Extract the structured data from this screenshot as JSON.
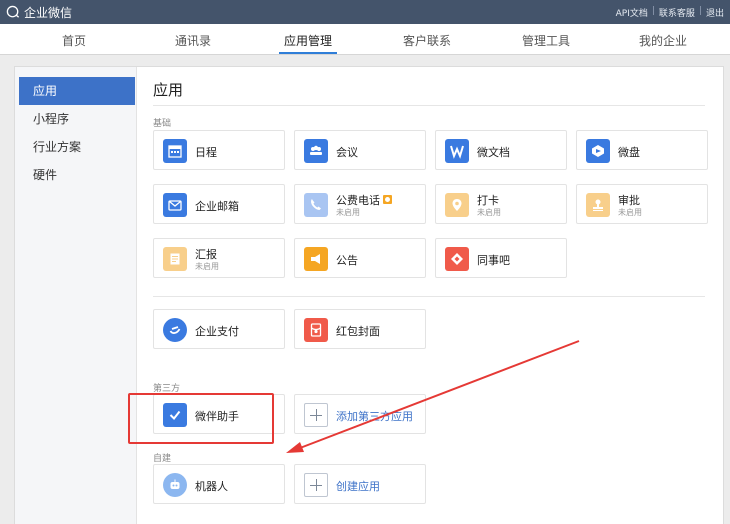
{
  "topbar": {
    "logo_text": "企业微信",
    "links": [
      "API文档",
      "联系客服",
      "退出"
    ]
  },
  "nav": {
    "items": [
      {
        "label": "首页"
      },
      {
        "label": "通讯录"
      },
      {
        "label": "应用管理"
      },
      {
        "label": "客户联系"
      },
      {
        "label": "管理工具"
      },
      {
        "label": "我的企业"
      }
    ],
    "active": "应用管理"
  },
  "sidebar": {
    "items": [
      {
        "label": "应用"
      },
      {
        "label": "小程序"
      },
      {
        "label": "行业方案"
      },
      {
        "label": "硬件"
      }
    ],
    "active": "应用"
  },
  "main": {
    "title": "应用",
    "sections": {
      "basic": "基础",
      "third_party": "第三方",
      "custom": "自建"
    },
    "apps": {
      "schedule": {
        "name": "日程"
      },
      "meeting": {
        "name": "会议"
      },
      "docs": {
        "name": "微文档"
      },
      "drive": {
        "name": "微盘"
      },
      "mail": {
        "name": "企业邮箱"
      },
      "phone": {
        "name": "公费电话",
        "status": "未启用"
      },
      "checkin": {
        "name": "打卡",
        "status": "未启用"
      },
      "approval": {
        "name": "审批",
        "status": "未启用"
      },
      "report": {
        "name": "汇报",
        "status": "未启用"
      },
      "notice": {
        "name": "公告"
      },
      "colleague": {
        "name": "同事吧"
      },
      "pay": {
        "name": "企业支付"
      },
      "redpacket": {
        "name": "红包封面"
      },
      "wejian": {
        "name": "微伴助手"
      },
      "add_third": {
        "name": "添加第三方应用"
      },
      "robot": {
        "name": "机器人"
      },
      "create": {
        "name": "创建应用"
      }
    },
    "icon_colors": {
      "schedule": "#3a7ae0",
      "meeting": "#3a7ae0",
      "docs": "#3a7ae0",
      "drive": "#3a7ae0",
      "mail": "#3a7ae0",
      "phone_disabled": "#a9c5f2",
      "checkin_disabled": "#f8cf8b",
      "approval_disabled": "#f8cf8b",
      "report_disabled": "#f8cf8b",
      "notice": "#f5a623",
      "colleague": "#f05a4a",
      "pay": "#3a7ae0",
      "redpacket": "#f05a4a",
      "wejian": "#3a7ae0",
      "robot": "#8cb7f0"
    },
    "annotation_color": "#e53935"
  }
}
